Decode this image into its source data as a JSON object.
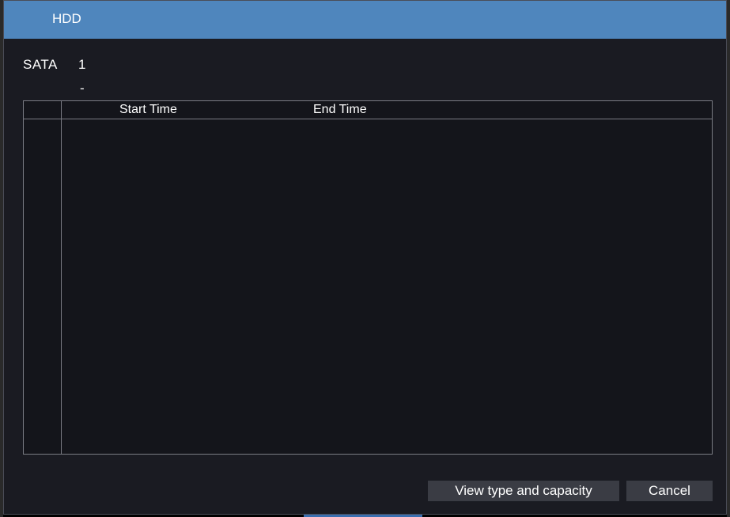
{
  "window": {
    "title": "HDD"
  },
  "disk": {
    "label": "SATA",
    "number": "1",
    "dash": "-"
  },
  "table": {
    "columns": [
      "",
      "Start Time",
      "End Time"
    ],
    "rows": []
  },
  "buttons": {
    "view_type_capacity": "View type and capacity",
    "cancel": "Cancel"
  },
  "colors": {
    "titlebar": "#4f86bd",
    "dialog_bg": "#1a1b22",
    "button_bg": "#3a3c44"
  }
}
